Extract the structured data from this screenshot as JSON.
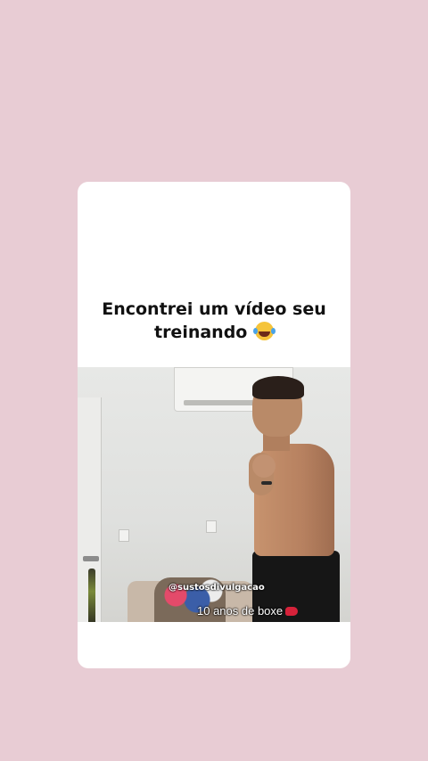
{
  "post": {
    "caption_line1": "Encontrei um vídeo seu",
    "caption_line2": "treinando",
    "caption_emoji": "face-with-tears-of-joy-icon"
  },
  "video": {
    "watermark": "@sustosdivulgacao",
    "overlay_text": "10 anos de boxe",
    "overlay_emoji": "boxing-glove-icon"
  },
  "colors": {
    "background": "#e8ccd4",
    "card": "#ffffff",
    "caption_text": "#111111"
  }
}
